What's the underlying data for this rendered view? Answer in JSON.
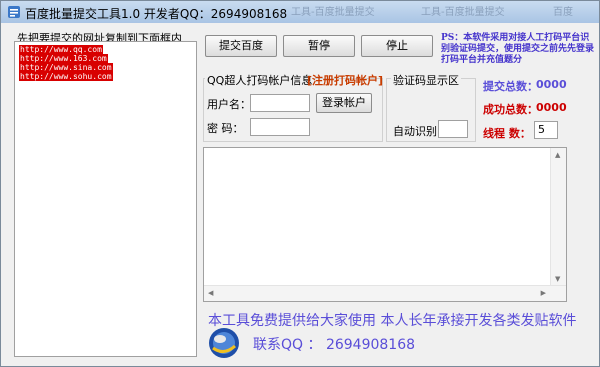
{
  "window": {
    "title": "百度批量提交工具1.0  开发者QQ：2694908168",
    "ghost_texts": [
      "工具-百度批量提交",
      "工具-百度批量提交",
      "百度"
    ]
  },
  "left": {
    "instruction": "先把要提交的网址复制到下面框内",
    "urls": [
      "http://www.qq.com",
      "http://www.163.com",
      "http://www.sina.com",
      "http://www.sohu.com"
    ]
  },
  "toolbar": {
    "submit_label": "提交百度",
    "pause_label": "暂停",
    "stop_label": "停止"
  },
  "ps_note": "PS：本软件采用对接人工打码平台识别验证码提交，使用提交之前先先登录打码平台并充值题分",
  "account": {
    "group_label": "QQ超人打码帐户信息",
    "register_link": "[注册打码帐户]",
    "username_label": "用户名：",
    "username_value": "",
    "password_label": "密   码：",
    "password_value": "",
    "login_label": "登录帐户"
  },
  "captcha": {
    "group_label": "验证码显示区",
    "auto_label": "自动识别：",
    "auto_value": ""
  },
  "stats": {
    "submitted_label": "提交总数：",
    "submitted_value": "0000",
    "success_label": "成功总数：",
    "success_value": "0000",
    "threads_label": "线程    数：",
    "threads_value": "5"
  },
  "colors": {
    "accent_blue": "#5a4ed8",
    "success_red": "#cc0000",
    "url_highlight": "#d80000"
  },
  "footer": {
    "line1": "本工具免费提供给大家使用     本人长年承接开发各类发贴软件",
    "contact": "联系QQ ： 2694908168"
  }
}
